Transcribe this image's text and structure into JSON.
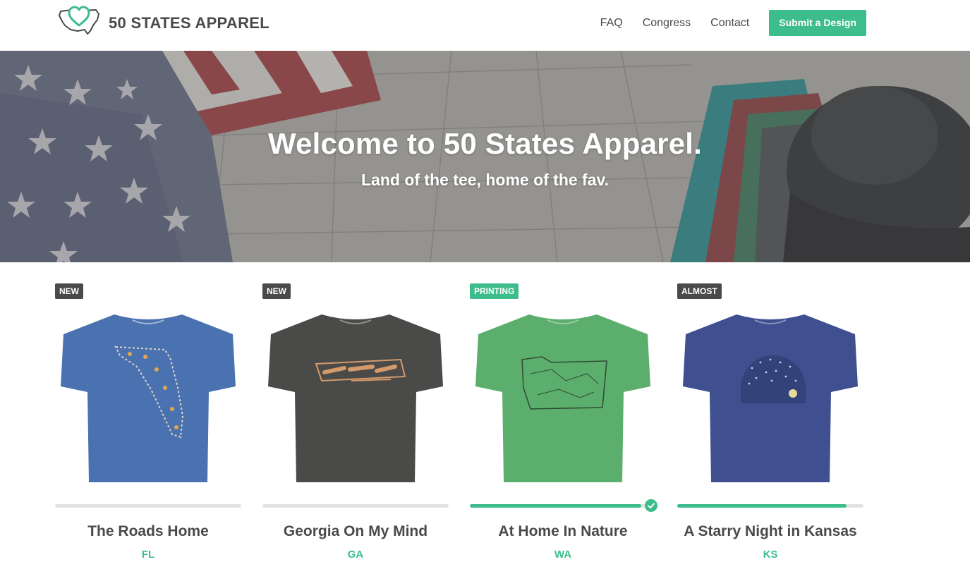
{
  "brand": {
    "name": "50 STATES APPAREL",
    "accent": "#3dbd8c",
    "text_color": "#4a4a4a"
  },
  "nav": {
    "items": [
      "FAQ",
      "Congress",
      "Contact"
    ],
    "cta": "Submit a Design"
  },
  "hero": {
    "title": "Welcome to 50 States Apparel.",
    "subtitle": "Land of the tee, home of the fav."
  },
  "products": [
    {
      "badge": "NEW",
      "title": "The Roads Home",
      "state": "FL",
      "shirt_color": "#4b72b0",
      "design": "florida-oranges",
      "progress": 0,
      "complete": false
    },
    {
      "badge": "NEW",
      "title": "Georgia On My Mind",
      "state": "GA",
      "shirt_color": "#4a4a48",
      "design": "georgia-lettering",
      "progress": 0,
      "complete": false
    },
    {
      "badge": "PRINTING",
      "title": "At Home In Nature",
      "state": "WA",
      "shirt_color": "#5cae6c",
      "design": "washington-map",
      "progress": 0.92,
      "complete": true
    },
    {
      "badge": "ALMOST",
      "title": "A Starry Night in Kansas",
      "state": "KS",
      "shirt_color": "#3f4f8f",
      "design": "starry-night",
      "progress": 0.91,
      "complete": false
    }
  ]
}
